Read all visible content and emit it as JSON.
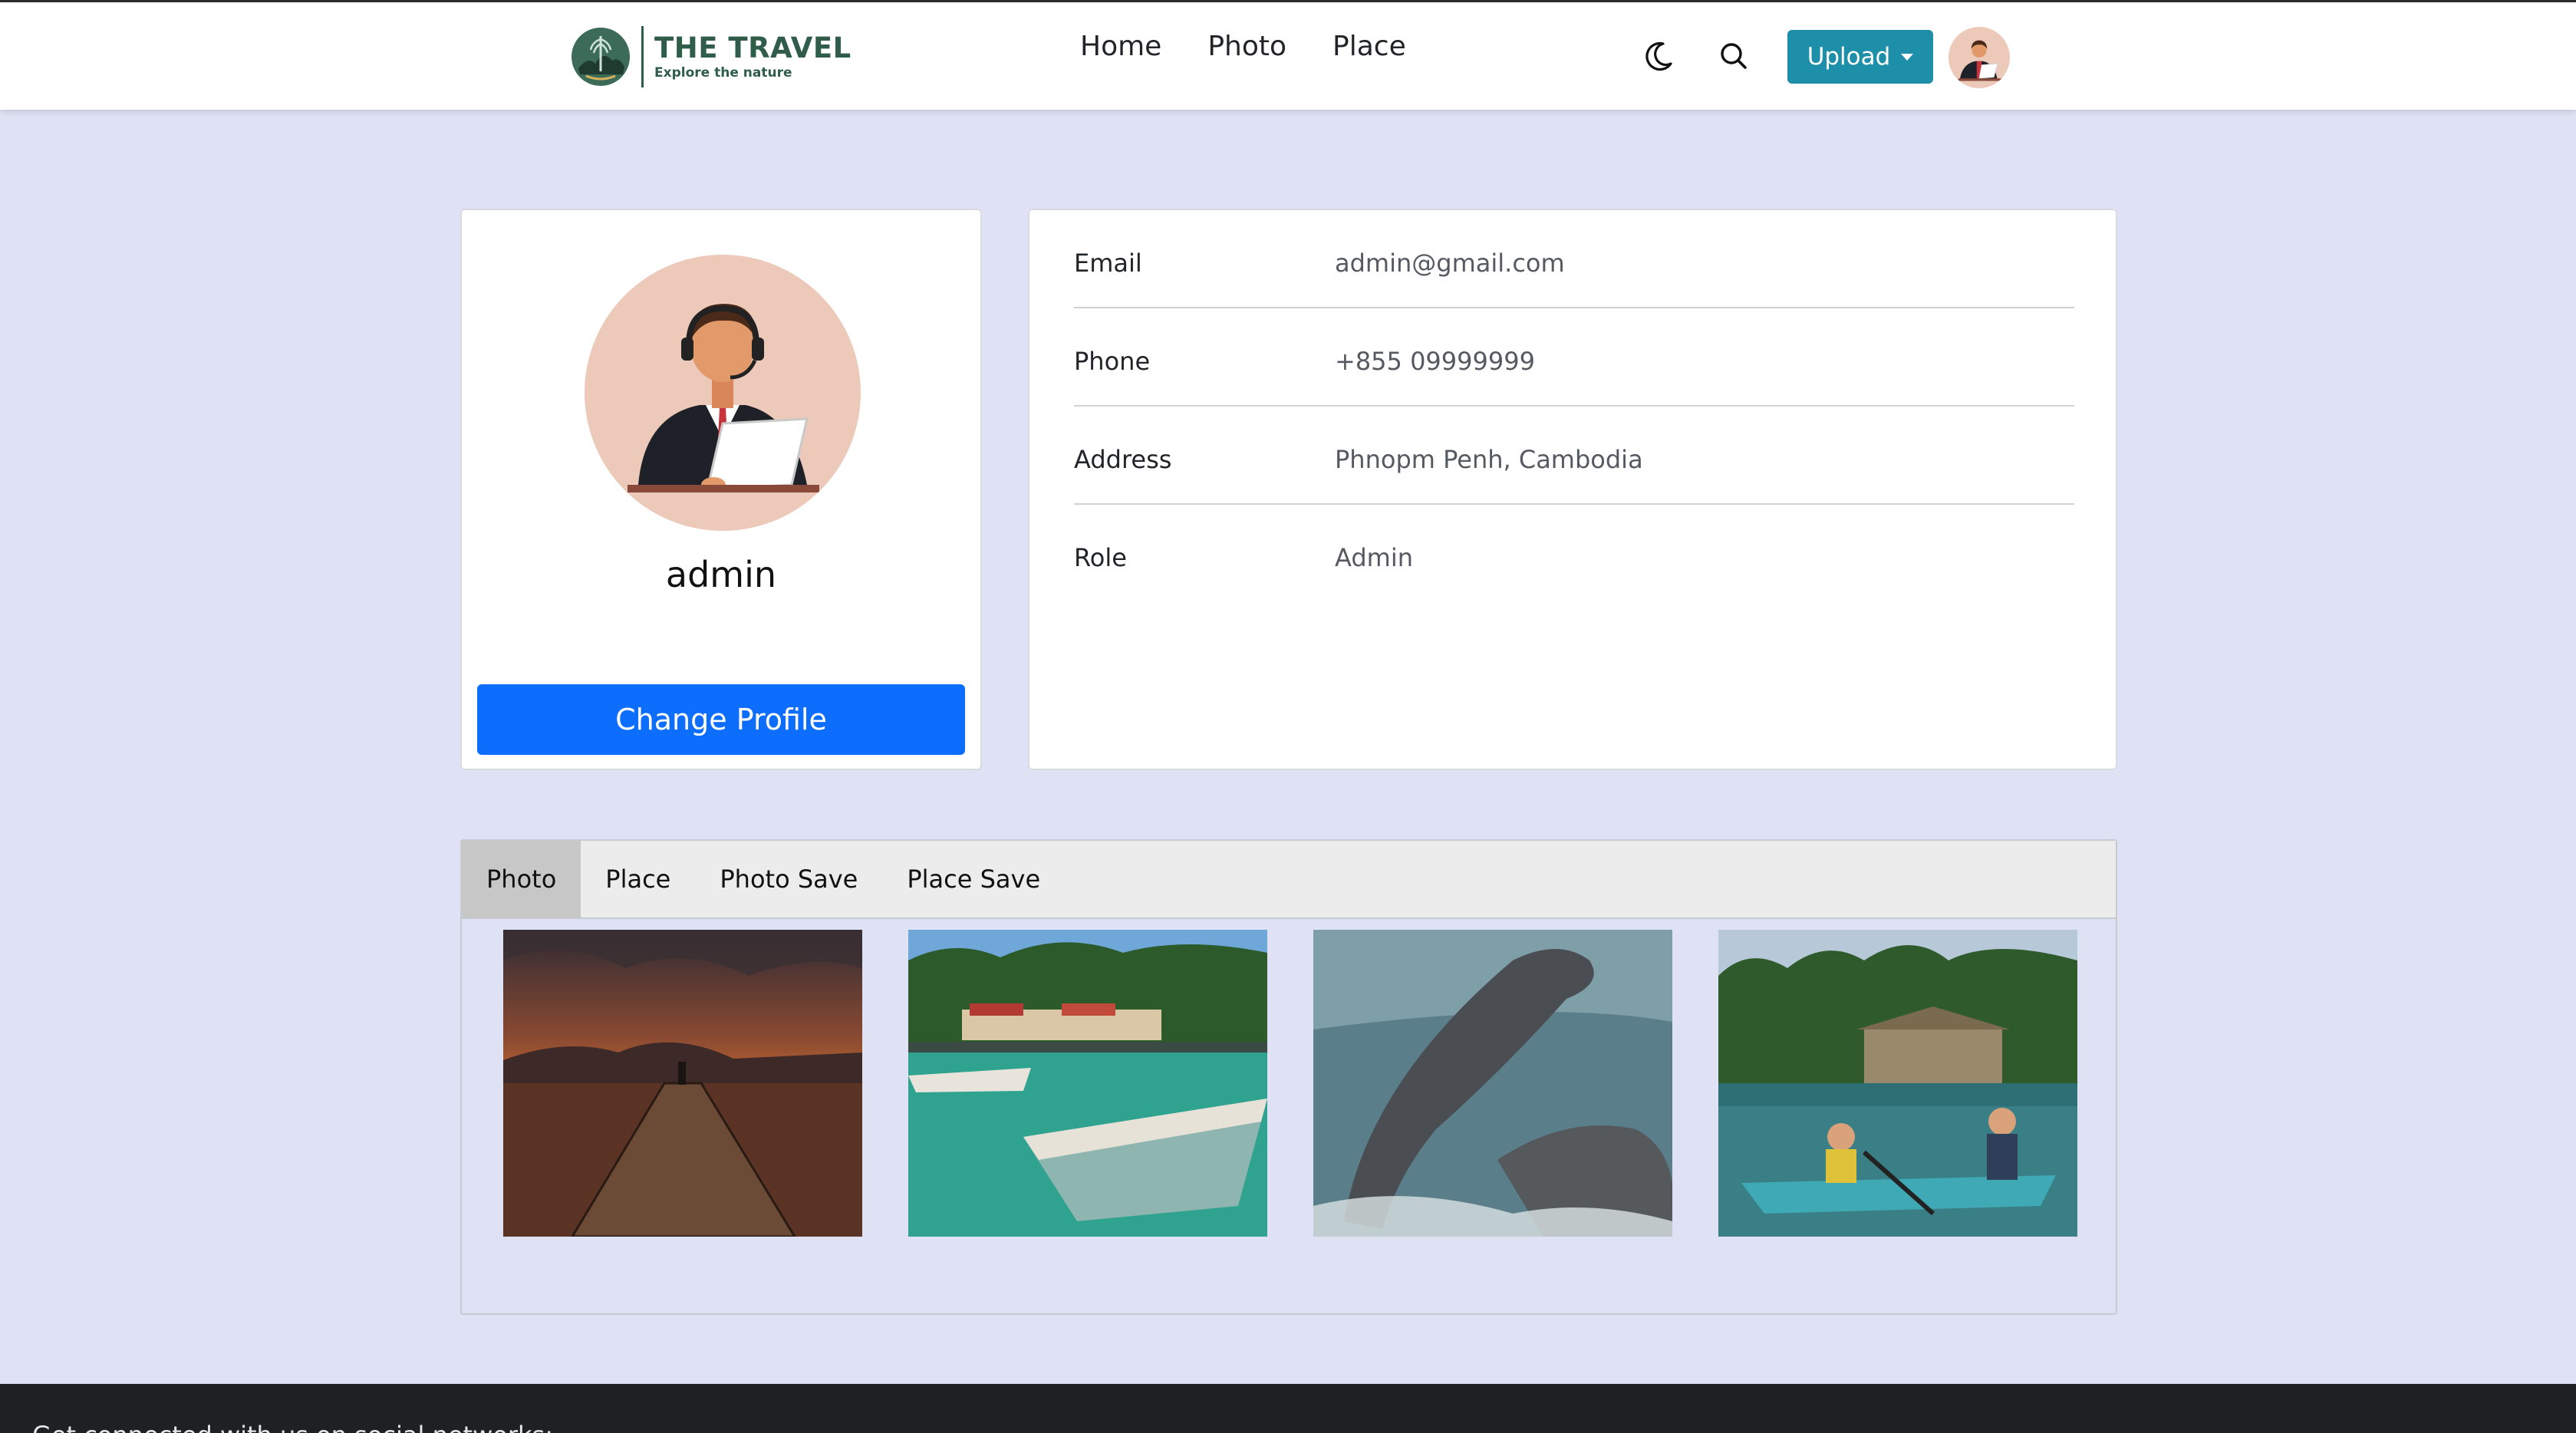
{
  "brand": {
    "title": "THE TRAVEL",
    "subtitle": "Explore the nature",
    "logo_icon": "travel-logo-icon"
  },
  "nav": {
    "links": [
      "Home",
      "Photo",
      "Place"
    ],
    "theme_icon": "moon-icon",
    "search_icon": "search-icon",
    "upload_label": "Upload"
  },
  "profile": {
    "username": "admin",
    "change_label": "Change Profile"
  },
  "info": [
    {
      "label": "Email",
      "value": "admin@gmail.com"
    },
    {
      "label": "Phone",
      "value": "+855 09999999"
    },
    {
      "label": "Address",
      "value": "Phnopm Penh, Cambodia"
    },
    {
      "label": "Role",
      "value": "Admin"
    }
  ],
  "tabs": [
    {
      "label": "Photo",
      "active": true
    },
    {
      "label": "Place",
      "active": false
    },
    {
      "label": "Photo Save",
      "active": false
    },
    {
      "label": "Place Save",
      "active": false
    }
  ],
  "photos": [
    {
      "name": "sunset-pier-photo"
    },
    {
      "name": "boats-harbor-photo"
    },
    {
      "name": "dolphin-photo"
    },
    {
      "name": "kayak-photo"
    }
  ],
  "footer": {
    "text": "Get connected with us on social networks:"
  },
  "colors": {
    "accent": "#1d8fa8",
    "primary": "#0d6efd",
    "background": "#dfe2f5",
    "brand": "#2f5d4a"
  }
}
